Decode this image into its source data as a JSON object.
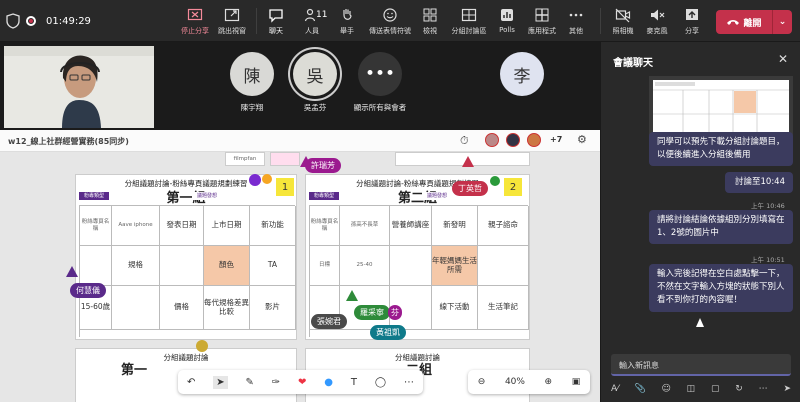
{
  "topbar": {
    "timer": "01:49:29",
    "buttons": {
      "stop_share": "停止分享",
      "popout": "跳出視窗",
      "chat": "聊天",
      "people": "人員",
      "people_count": "11",
      "raise": "舉手",
      "reactions": "傳送表情符號",
      "view": "檢視",
      "rooms": "分組討論區",
      "polls": "Polls",
      "apps": "應用程式",
      "more": "其他",
      "camera": "照相機",
      "mic": "麥克風",
      "share": "分享"
    },
    "leave_label": "離開"
  },
  "participants": [
    {
      "initial": "陳",
      "name": "陳宇翔",
      "bg": "#d9d9d6"
    },
    {
      "initial": "吳",
      "name": "吳孟芬",
      "bg": "#dcdcd6"
    },
    {
      "initial": "•••",
      "name": "顯示所有與會者",
      "bg": "#353535"
    },
    {
      "initial": "李",
      "name": "",
      "bg": "#dfe3f0"
    }
  ],
  "share": {
    "title": "w12_線上社群經營實務(85同步)",
    "extra_count": "+7"
  },
  "board": {
    "panel1": {
      "header": "分組議題討論-粉絲專頁議題規劃練習",
      "group": "第一組",
      "badge": "1"
    },
    "panel2": {
      "header": "分組議題討論-粉絲專頁議題規劃練習",
      "group": "第二組",
      "badge": "2"
    },
    "panel3": {
      "header": "分組議題討論",
      "group": "第一"
    },
    "panel4": {
      "header": "分組議題討論",
      "group": "二組"
    },
    "top_note_left": "filmpfan",
    "legend_a": "粉專類型",
    "legend_b": "議題發想",
    "g1_cells": [
      "粉絲專頁名稱",
      "Aave iphone",
      "",
      "",
      "",
      "發表日期",
      "上市日期",
      "新功能",
      "",
      "特色與發想功能",
      "",
      "",
      "",
      "規格",
      "",
      "顏色",
      "TA",
      "15-60歲",
      "",
      "價格",
      "每代規格差異比較",
      "影片"
    ],
    "g2_cells": [
      "粉絲專頁名稱",
      "孫高不長草",
      "",
      "",
      "",
      "營養師講座",
      "新發明",
      "親子諮命",
      "",
      "",
      "",
      "",
      "日標",
      "",
      "年輕媽媽生活所需",
      "",
      "",
      "",
      "",
      "",
      "線下活動",
      "生活筆記"
    ],
    "g2_small": "25-40",
    "tags": [
      {
        "label": "許瑞芳",
        "color": "#9b1a8f"
      },
      {
        "label": "丁英哲",
        "color": "#c4314b"
      },
      {
        "label": "何慧儀",
        "color": "#5a2a8a"
      },
      {
        "label": "羅采寧",
        "color": "#2e8b3a"
      },
      {
        "label": "張婉君",
        "color": "#4a4a4a"
      },
      {
        "label": "黃祖凱",
        "color": "#0f7a8a"
      },
      {
        "label": "芬",
        "color": "#9b1a8f"
      }
    ]
  },
  "zoom": "40%",
  "chat": {
    "title": "會議聊天",
    "messages": [
      {
        "text": "同學可以預先下載分組討論題目，以便後續進入分組後備用"
      },
      {
        "text": "討論至10:44"
      },
      {
        "time": "上午 10:46",
        "text": "請將討論結論依據組別分別填寫在1、2號的圖片中"
      },
      {
        "time": "上午 10:51",
        "text": "輸入完後記得在空白處點擊一下，不然在文字輸入方塊的狀態下別人看不到你打的內容喔！"
      }
    ],
    "input_placeholder": "輸入新訊息"
  },
  "colors": {
    "accent": "#6264a7",
    "leave": "#c4314b",
    "yellow": "#f6e63a"
  }
}
